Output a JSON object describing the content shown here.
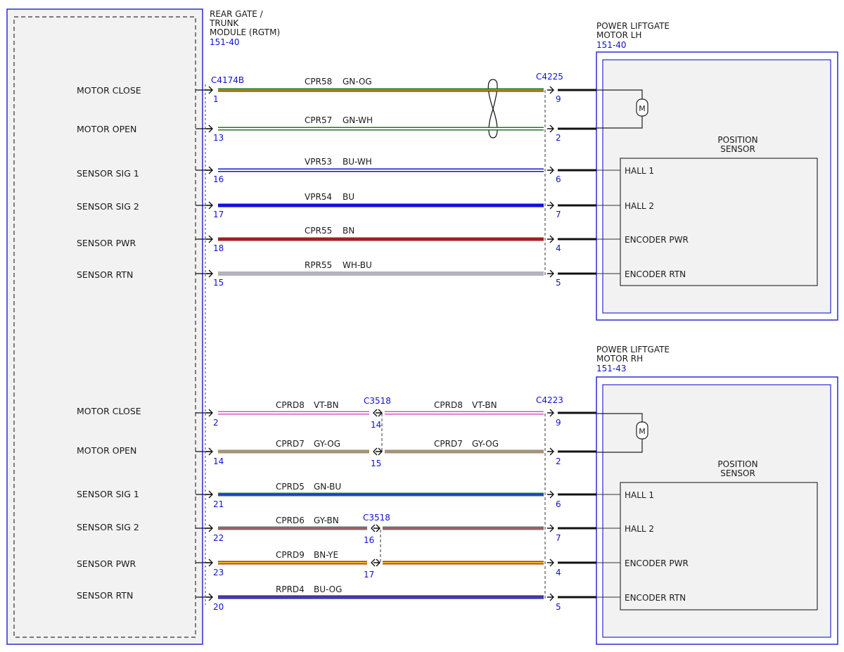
{
  "module": {
    "name_lines": [
      "REAR GATE /",
      "TRUNK",
      "MODULE (RGTM)"
    ],
    "ref": "151-40"
  },
  "motor_lh": {
    "name_lines": [
      "POWER LIFTGATE",
      "MOTOR LH"
    ],
    "ref": "151-40",
    "sensor_lines": [
      "POSITION",
      "SENSOR"
    ],
    "motor_symbol": "M",
    "module_connector": "C4174B",
    "motor_connector": "C4225",
    "circuits": [
      {
        "function": "MOTOR CLOSE",
        "circuit": "CPR58",
        "color": "GN-OG",
        "module_pin": "1",
        "motor_pin": "9",
        "sensor_label": "",
        "c1": "#1e7a1e",
        "c2": "#e07a10"
      },
      {
        "function": "MOTOR OPEN",
        "circuit": "CPR57",
        "color": "GN-WH",
        "module_pin": "13",
        "motor_pin": "2",
        "sensor_label": "",
        "c1": "#1e7a1e",
        "c2": "#ffffff"
      },
      {
        "function": "SENSOR SIG 1",
        "circuit": "VPR53",
        "color": "BU-WH",
        "module_pin": "16",
        "motor_pin": "6",
        "sensor_label": "HALL 1",
        "c1": "#1010e0",
        "c2": "#ffffff"
      },
      {
        "function": "SENSOR SIG 2",
        "circuit": "VPR54",
        "color": "BU",
        "module_pin": "17",
        "motor_pin": "7",
        "sensor_label": "HALL 2",
        "c1": "#1010e0",
        "c2": "#1010e0"
      },
      {
        "function": "SENSOR PWR",
        "circuit": "CPR55",
        "color": "BN",
        "module_pin": "18",
        "motor_pin": "4",
        "sensor_label": "ENCODER PWR",
        "c1": "#a02020",
        "c2": "#a02020"
      },
      {
        "function": "SENSOR RTN",
        "circuit": "RPR55",
        "color": "WH-BU",
        "module_pin": "15",
        "motor_pin": "5",
        "sensor_label": "ENCODER RTN",
        "c1": "#ffffff",
        "c2": "#3030c0"
      }
    ]
  },
  "motor_rh": {
    "name_lines": [
      "POWER LIFTGATE",
      "MOTOR RH"
    ],
    "ref": "151-43",
    "sensor_lines": [
      "POSITION",
      "SENSOR"
    ],
    "motor_symbol": "M",
    "inline_connector": "C3518",
    "motor_connector": "C4223",
    "circuits": [
      {
        "function": "MOTOR CLOSE",
        "circuit": "CPRD8",
        "color": "VT-BN",
        "module_pin": "2",
        "inline_pin": "14",
        "right_circuit": "CPRD8",
        "right_color": "VT-BN",
        "motor_pin": "9",
        "sensor_label": "",
        "c1": "#e050c0",
        "c2": "#ffffff"
      },
      {
        "function": "MOTOR OPEN",
        "circuit": "CPRD7",
        "color": "GY-OG",
        "module_pin": "14",
        "inline_pin": "15",
        "right_circuit": "CPRD7",
        "right_color": "GY-OG",
        "motor_pin": "2",
        "sensor_label": "",
        "c1": "#909090",
        "c2": "#e08a20"
      },
      {
        "function": "SENSOR SIG 1",
        "circuit": "CPRD5",
        "color": "GN-BU",
        "module_pin": "21",
        "inline_pin": "",
        "right_circuit": "",
        "right_color": "",
        "motor_pin": "6",
        "sensor_label": "HALL 1",
        "c1": "#1e7a1e",
        "c2": "#1a40c0"
      },
      {
        "function": "SENSOR SIG 2",
        "circuit": "CPRD6",
        "color": "GY-BN",
        "module_pin": "22",
        "inline_pin": "16",
        "right_circuit": "",
        "right_color": "",
        "motor_pin": "7",
        "sensor_label": "HALL 2",
        "c1": "#707070",
        "c2": "#a06060"
      },
      {
        "function": "SENSOR PWR",
        "circuit": "CPRD9",
        "color": "BN-YE",
        "module_pin": "23",
        "inline_pin": "17",
        "right_circuit": "",
        "right_color": "",
        "motor_pin": "4",
        "sensor_label": "ENCODER PWR",
        "c1": "#b03010",
        "c2": "#e8c020"
      },
      {
        "function": "SENSOR RTN",
        "circuit": "RPRD4",
        "color": "BU-OG",
        "module_pin": "20",
        "inline_pin": "",
        "right_circuit": "",
        "right_color": "",
        "motor_pin": "5",
        "sensor_label": "ENCODER RTN",
        "c1": "#2020a0",
        "c2": "#6040a0"
      }
    ]
  }
}
